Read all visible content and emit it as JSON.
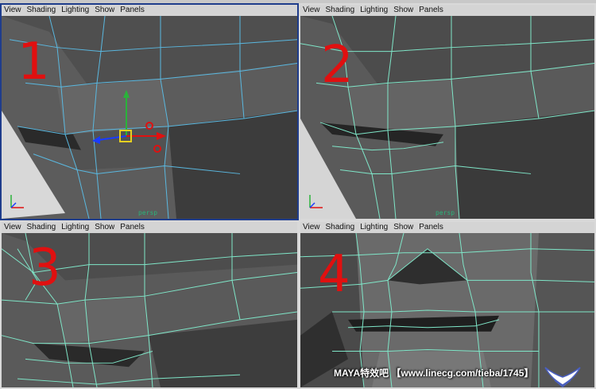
{
  "viewports": [
    {
      "menu": [
        "View",
        "Shading",
        "Lighting",
        "Show",
        "Panels"
      ],
      "number": "1",
      "camera": "persp"
    },
    {
      "menu": [
        "View",
        "Shading",
        "Lighting",
        "Show",
        "Panels"
      ],
      "number": "2",
      "camera": "persp"
    },
    {
      "menu": [
        "View",
        "Shading",
        "Lighting",
        "Show",
        "Panels"
      ],
      "number": "3",
      "camera": ""
    },
    {
      "menu": [
        "View",
        "Shading",
        "Lighting",
        "Show",
        "Panels"
      ],
      "number": "4",
      "camera": ""
    }
  ],
  "watermark": "MAYA特效吧 【www.linecg.com/tieba/1745】",
  "colors": {
    "wire": "#7fe6c8",
    "selection_wire": "#5ab8e0",
    "mesh": "#5a5a5a",
    "active_border": "#1f3d8c",
    "label": "#e01010"
  },
  "icons": [
    "move-manipulator-icon",
    "axis-indicator-icon",
    "watermark-logo-icon"
  ]
}
